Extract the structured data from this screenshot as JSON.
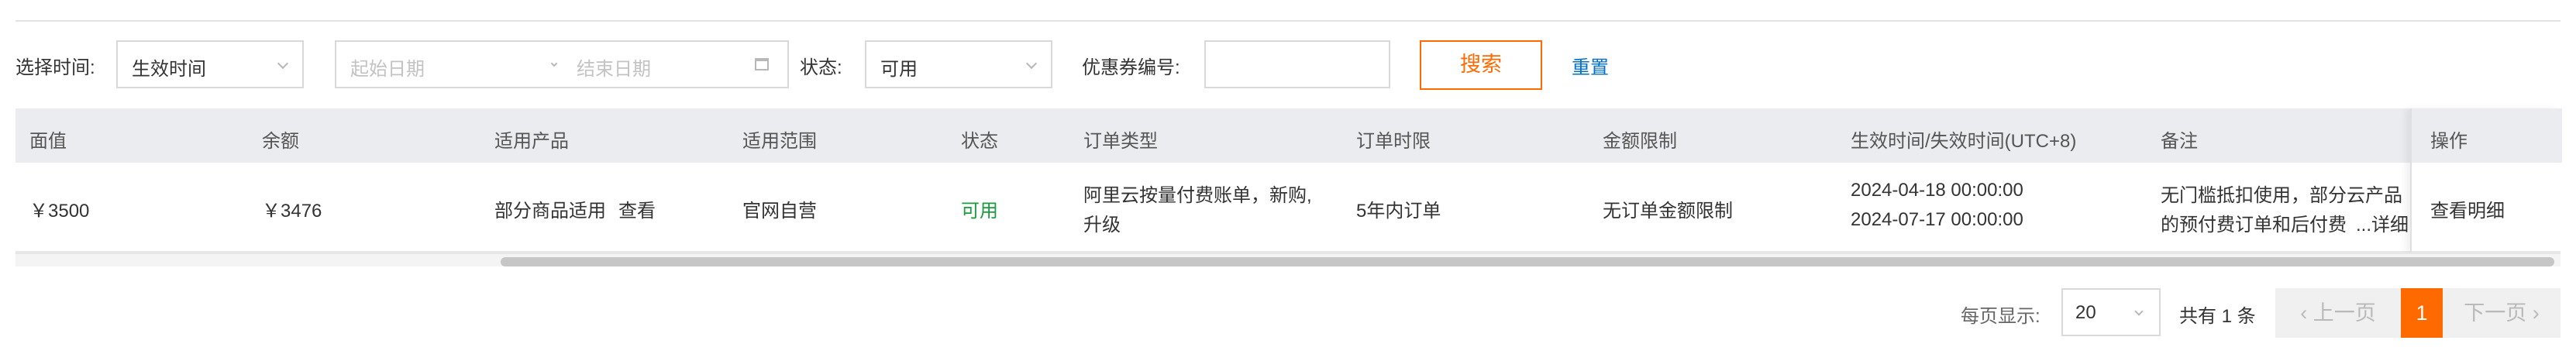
{
  "filters": {
    "time_label": "选择时间:",
    "time_select_value": "生效时间",
    "start_date_placeholder": "起始日期",
    "end_date_placeholder": "结束日期",
    "status_label": "状态:",
    "status_select_value": "可用",
    "coupon_no_label": "优惠券编号:",
    "coupon_no_value": "",
    "search_button": "搜索",
    "reset_link": "重置"
  },
  "table": {
    "headers": [
      "面值",
      "余额",
      "适用产品",
      "适用范围",
      "状态",
      "订单类型",
      "订单时限",
      "金额限制",
      "生效时间/失效时间(UTC+8)",
      "备注",
      "操作"
    ],
    "rows": [
      {
        "face_value": "￥3500",
        "balance": "￥3476",
        "product": "部分商品适用",
        "product_link": "查看",
        "scope": "官网自营",
        "status": "可用",
        "order_type_line1": "阿里云按量付费账单，新购,",
        "order_type_line2": "升级",
        "order_limit": "5年内订单",
        "amount_limit": "无订单金额限制",
        "effective_time": "2024-04-18 00:00:00",
        "expire_time": "2024-07-17 00:00:00",
        "remark_line1": "无门槛抵扣使用，部分云产品",
        "remark_line2": "的预付费订单和后付费",
        "remark_more": "...详细",
        "action": "查看明细"
      }
    ]
  },
  "pagination": {
    "page_size_label": "每页显示:",
    "page_size_value": "20",
    "total_text": "共有 1 条",
    "prev_label": "上一页",
    "current_page": "1",
    "next_label": "下一页"
  },
  "colors": {
    "accent": "#ff6a00",
    "link": "#0070cc",
    "status_available": "#1a9c3c",
    "header_bg": "#ebecef"
  }
}
